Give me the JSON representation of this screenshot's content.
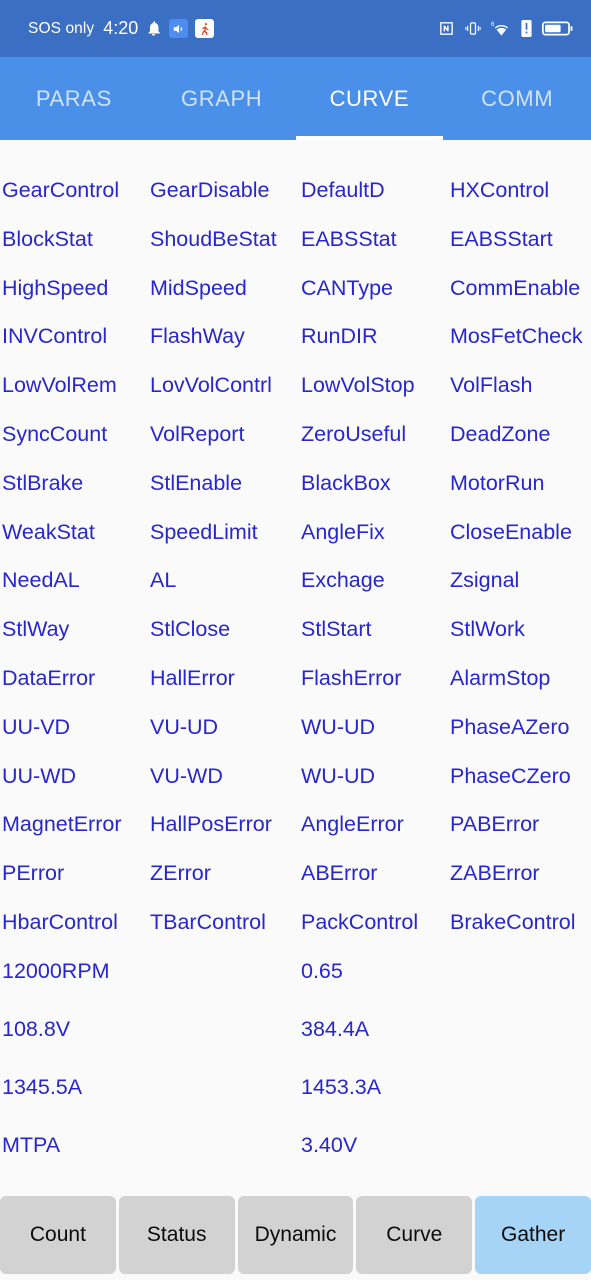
{
  "statusbar": {
    "carrier": "SOS only",
    "time": "4:20",
    "icons_left": [
      "bell-icon",
      "app-blue-icon",
      "app-runner-icon"
    ],
    "icons_right": [
      "nfc-icon",
      "vibrate-icon",
      "wifi6-icon",
      "alert-icon",
      "battery-icon"
    ]
  },
  "tabs": [
    {
      "label": "PARAS",
      "active": false
    },
    {
      "label": "GRAPH",
      "active": false
    },
    {
      "label": "CURVE",
      "active": true
    },
    {
      "label": "COMM",
      "active": false
    }
  ],
  "grid": {
    "rows": [
      [
        "GearControl",
        "GearDisable",
        "DefaultD",
        "HXControl"
      ],
      [
        "BlockStat",
        "ShoudBeStat",
        "EABSStat",
        "EABSStart"
      ],
      [
        "HighSpeed",
        "MidSpeed",
        "CANType",
        "CommEnable"
      ],
      [
        "INVControl",
        "FlashWay",
        "RunDIR",
        "MosFetCheck"
      ],
      [
        "LowVolRem",
        "LovVolContrl",
        "LowVolStop",
        "VolFlash"
      ],
      [
        "SyncCount",
        "VolReport",
        "ZeroUseful",
        "DeadZone"
      ],
      [
        "StlBrake",
        "StlEnable",
        "BlackBox",
        "MotorRun"
      ],
      [
        "WeakStat",
        "SpeedLimit",
        "AngleFix",
        "CloseEnable"
      ],
      [
        "NeedAL",
        "AL",
        "Exchage",
        "Zsignal"
      ],
      [
        "StlWay",
        "StlClose",
        "StlStart",
        "StlWork"
      ],
      [
        "DataError",
        "HallError",
        "FlashError",
        "AlarmStop"
      ],
      [
        "UU-VD",
        "VU-UD",
        "WU-UD",
        "PhaseAZero"
      ],
      [
        "UU-WD",
        "VU-WD",
        "WU-UD",
        "PhaseCZero"
      ],
      [
        "MagnetError",
        "HallPosError",
        "AngleError",
        "PABError"
      ],
      [
        "PError",
        "ZError",
        "ABError",
        "ZABError"
      ],
      [
        "HbarControl",
        "TBarControl",
        "PackControl",
        "BrakeControl"
      ]
    ]
  },
  "values": {
    "rows": [
      [
        "12000RPM",
        "0.65"
      ],
      [
        "108.8V",
        "384.4A"
      ],
      [
        "1345.5A",
        "1453.3A"
      ],
      [
        "MTPA",
        "3.40V"
      ]
    ]
  },
  "bottom_buttons": [
    {
      "label": "Count",
      "active": false
    },
    {
      "label": "Status",
      "active": false
    },
    {
      "label": "Dynamic",
      "active": false
    },
    {
      "label": "Curve",
      "active": false
    },
    {
      "label": "Gather",
      "active": true
    }
  ],
  "colors": {
    "statusbar_bg": "#3a6fc4",
    "tabbar_bg": "#4a90e8",
    "text_blue": "#2726cf",
    "page_bg": "#fafafa",
    "button_bg": "#d2d2d2",
    "button_active_bg": "#a5d4f7"
  }
}
